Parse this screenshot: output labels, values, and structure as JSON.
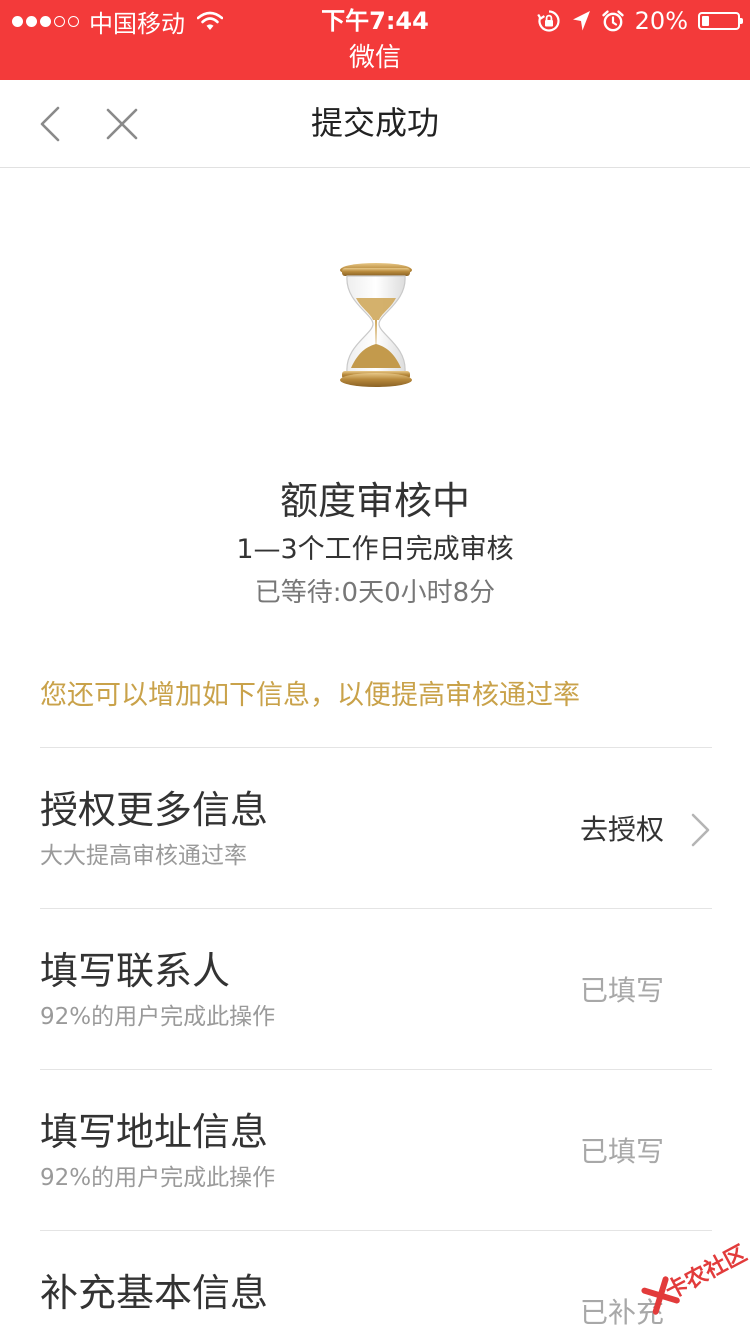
{
  "status_bar": {
    "carrier": "中国移动",
    "time": "下午7:44",
    "battery": "20%",
    "battery_level": 0.2,
    "app_name": "微信",
    "bg_color": "#f33a3a"
  },
  "nav": {
    "title": "提交成功",
    "back_icon": "chevron-left-icon",
    "close_icon": "close-icon"
  },
  "status": {
    "icon": "hourglass-icon",
    "title": "额度审核中",
    "duration": "1—3个工作日完成审核",
    "waited": "已等待:0天0小时8分"
  },
  "tip": {
    "text": "您还可以增加如下信息，以便提高审核通过率",
    "color": "#c9a24a"
  },
  "items": [
    {
      "title": "授权更多信息",
      "subtitle": "大大提高审核通过率",
      "action": "去授权",
      "done": false
    },
    {
      "title": "填写联系人",
      "subtitle": "92%的用户完成此操作",
      "action": "已填写",
      "done": true
    },
    {
      "title": "填写地址信息",
      "subtitle": "92%的用户完成此操作",
      "action": "已填写",
      "done": true
    },
    {
      "title": "补充基本信息",
      "subtitle": "",
      "action": "已补充",
      "done": true
    }
  ],
  "watermark": {
    "text": "卡农社区"
  }
}
